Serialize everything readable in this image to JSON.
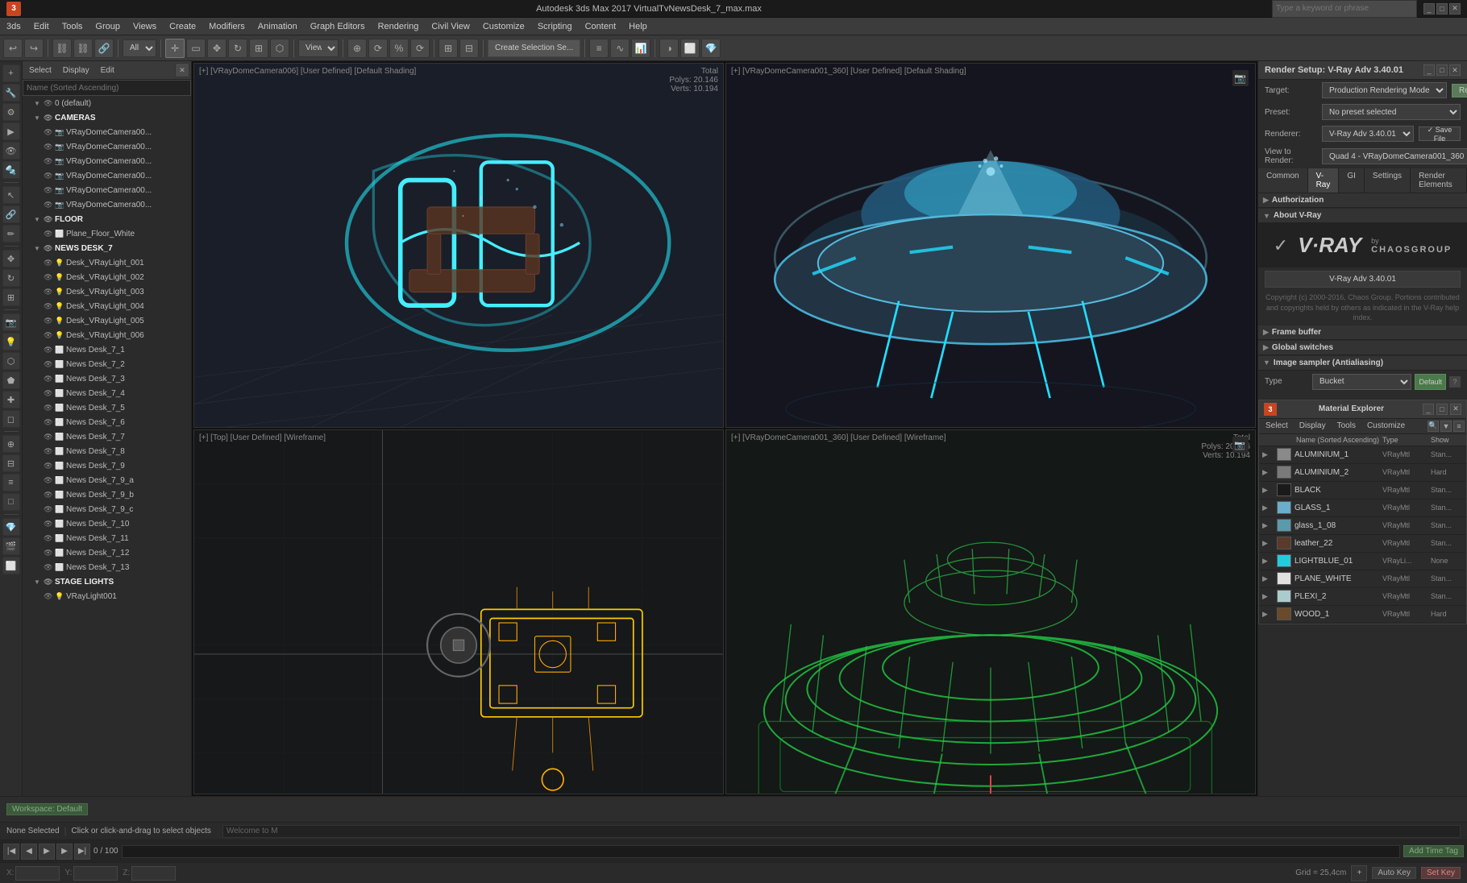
{
  "titleBar": {
    "logo": "3",
    "title": "Autodesk 3ds Max 2017  VirtualTvNewsDesk_7_max.max",
    "searchPlaceholder": "Type a keyword or phrase",
    "renderSetupTitle": "Render Setup: V-Ray Adv 3.40.01",
    "buttons": [
      "_",
      "□",
      "✕"
    ]
  },
  "menuBar": {
    "items": [
      "3",
      "Edit",
      "Tools",
      "Group",
      "Views",
      "Create",
      "Modifiers",
      "Animation",
      "Graph Editors",
      "Rendering",
      "Civil View",
      "Customize",
      "Scripting",
      "Content",
      "Help"
    ]
  },
  "toolbar": {
    "workspace": "Workspace: Default",
    "view": "View",
    "createSelection": "Create Selection Se...",
    "allLabel": "All"
  },
  "sceneTabs": {
    "select": "Select",
    "display": "Display",
    "edit": "Edit"
  },
  "sceneTree": {
    "searchPlaceholder": "Name (Sorted Ascending)",
    "items": [
      {
        "id": "default",
        "label": "0 (default)",
        "indent": 1,
        "type": "group",
        "expanded": true
      },
      {
        "id": "cameras-group",
        "label": "CAMERAS",
        "indent": 1,
        "type": "group",
        "expanded": true
      },
      {
        "id": "cam1",
        "label": "VRayDomeCamera00...",
        "indent": 2,
        "type": "camera"
      },
      {
        "id": "cam2",
        "label": "VRayDomeCamera00...",
        "indent": 2,
        "type": "camera"
      },
      {
        "id": "cam3",
        "label": "VRayDomeCamera00...",
        "indent": 2,
        "type": "camera"
      },
      {
        "id": "cam4",
        "label": "VRayDomeCamera00...",
        "indent": 2,
        "type": "camera"
      },
      {
        "id": "cam5",
        "label": "VRayDomeCamera00...",
        "indent": 2,
        "type": "camera"
      },
      {
        "id": "cam6",
        "label": "VRayDomeCamera00...",
        "indent": 2,
        "type": "camera"
      },
      {
        "id": "floor-group",
        "label": "FLOOR",
        "indent": 1,
        "type": "group",
        "expanded": true
      },
      {
        "id": "plane",
        "label": "Plane_Floor_White",
        "indent": 2,
        "type": "mesh"
      },
      {
        "id": "newsdesk-group",
        "label": "NEWS DESK_7",
        "indent": 1,
        "type": "group",
        "expanded": true
      },
      {
        "id": "desk1",
        "label": "Desk_VRayLight_001",
        "indent": 2,
        "type": "light"
      },
      {
        "id": "desk2",
        "label": "Desk_VRayLight_002",
        "indent": 2,
        "type": "light"
      },
      {
        "id": "desk3",
        "label": "Desk_VRayLight_003",
        "indent": 2,
        "type": "light"
      },
      {
        "id": "desk4",
        "label": "Desk_VRayLight_004",
        "indent": 2,
        "type": "light"
      },
      {
        "id": "desk5",
        "label": "Desk_VRayLight_005",
        "indent": 2,
        "type": "light"
      },
      {
        "id": "desk6",
        "label": "Desk_VRayLight_006",
        "indent": 2,
        "type": "light"
      },
      {
        "id": "news1",
        "label": "News Desk_7_1",
        "indent": 2,
        "type": "mesh"
      },
      {
        "id": "news2",
        "label": "News Desk_7_2",
        "indent": 2,
        "type": "mesh"
      },
      {
        "id": "news3",
        "label": "News Desk_7_3",
        "indent": 2,
        "type": "mesh"
      },
      {
        "id": "news4",
        "label": "News Desk_7_4",
        "indent": 2,
        "type": "mesh"
      },
      {
        "id": "news5",
        "label": "News Desk_7_5",
        "indent": 2,
        "type": "mesh"
      },
      {
        "id": "news6",
        "label": "News Desk_7_6",
        "indent": 2,
        "type": "mesh"
      },
      {
        "id": "news7",
        "label": "News Desk_7_7",
        "indent": 2,
        "type": "mesh"
      },
      {
        "id": "news8",
        "label": "News Desk_7_8",
        "indent": 2,
        "type": "mesh"
      },
      {
        "id": "news9",
        "label": "News Desk_7_9",
        "indent": 2,
        "type": "mesh"
      },
      {
        "id": "news9a",
        "label": "News Desk_7_9_a",
        "indent": 2,
        "type": "mesh"
      },
      {
        "id": "news9b",
        "label": "News Desk_7_9_b",
        "indent": 2,
        "type": "mesh"
      },
      {
        "id": "news9c",
        "label": "News Desk_7_9_c",
        "indent": 2,
        "type": "mesh"
      },
      {
        "id": "news10",
        "label": "News Desk_7_10",
        "indent": 2,
        "type": "mesh"
      },
      {
        "id": "news11",
        "label": "News Desk_7_11",
        "indent": 2,
        "type": "mesh"
      },
      {
        "id": "news12",
        "label": "News Desk_7_12",
        "indent": 2,
        "type": "mesh"
      },
      {
        "id": "news13",
        "label": "News Desk_7_13",
        "indent": 2,
        "type": "mesh"
      },
      {
        "id": "stage-group",
        "label": "STAGE LIGHTS",
        "indent": 1,
        "type": "group",
        "expanded": true
      },
      {
        "id": "vraylight1",
        "label": "VRayLight001",
        "indent": 2,
        "type": "light"
      }
    ]
  },
  "viewports": [
    {
      "id": "vp1",
      "label": "[+] [VRayDomeCamera006] [User Defined] [Default Shading]",
      "stats": "Total\nPolys: 20.146\nVerts: 10.194",
      "type": "shaded"
    },
    {
      "id": "vp2",
      "label": "[+] [VRayDomeCamera001_360] [User Defined] [Default Shading]",
      "stats": "",
      "type": "shaded360"
    },
    {
      "id": "vp3",
      "label": "[+] [Top] [User Defined] [Wireframe]",
      "stats": "",
      "type": "wireframe-top"
    },
    {
      "id": "vp4",
      "label": "[+] [VRayDomeCamera001_360] [User Defined] [Wireframe]",
      "stats": "Total\nPolys: 20.146\nVerts: 10.194",
      "type": "wireframe360"
    }
  ],
  "renderSetup": {
    "title": "Render Setup: V-Ray Adv 3.40.01",
    "targetLabel": "Target:",
    "targetValue": "Production Rendering Mode",
    "presetLabel": "Preset:",
    "presetValue": "No preset selected",
    "rendererLabel": "Renderer:",
    "rendererValue": "V-Ray Adv 3.40.01",
    "viewToRenderLabel": "View to\nRender:",
    "viewToRenderValue": "Quad 4 - VRayDomeCamera001_360",
    "renderButton": "Render",
    "saveFileButton": "✓ Save File",
    "tabs": [
      "Common",
      "V-Ray",
      "GI",
      "Settings",
      "Render Elements"
    ],
    "activeTab": "V-Ray",
    "sections": [
      {
        "label": "Authorization",
        "expanded": false
      },
      {
        "label": "About V-Ray",
        "expanded": true
      }
    ],
    "vrayVersion": "V-Ray Adv 3.40.01",
    "vrayCopyright": "Copyright (c) 2000-2016, Chaos Group.\nPortions contributed and copyrights held by others as indicated\nin the V-Ray help index.",
    "framebuffer": "Frame buffer",
    "globalSwitches": "Global switches",
    "imageSampler": "Image sampler (Antialiasing)",
    "typeLabel": "Type",
    "typeValue": "Bucket",
    "defaultLabel": "Default"
  },
  "materialExplorer": {
    "title": "Material Explorer",
    "toolbar": [
      "Select",
      "Display",
      "Tools",
      "Customize"
    ],
    "searchPlaceholder": "Name (Sorted Ascending)",
    "columns": [
      "Name (Sorted Ascending)",
      "Type",
      "Show"
    ],
    "materials": [
      {
        "name": "ALUMINIUM_1",
        "type": "VRayMtl",
        "show": "Stan...",
        "color": "#8a8a8a"
      },
      {
        "name": "ALUMINIUM_2",
        "type": "VRayMtl",
        "show": "Hard",
        "color": "#7a7a7a"
      },
      {
        "name": "BLACK",
        "type": "VRayMtl",
        "show": "Stan...",
        "color": "#1a1a1a"
      },
      {
        "name": "GLASS_1",
        "type": "VRayMtl",
        "show": "Stan...",
        "color": "#6aadcc"
      },
      {
        "name": "glass_1_08",
        "type": "VRayMtl",
        "show": "Stan...",
        "color": "#5a9aaa"
      },
      {
        "name": "leather_22",
        "type": "VRayMtl",
        "show": "Stan...",
        "color": "#5a3a2a"
      },
      {
        "name": "LIGHTBLUE_01",
        "type": "VRayLi...",
        "show": "None",
        "color": "#22ccdd"
      },
      {
        "name": "PLANE_WHITE",
        "type": "VRayMtl",
        "show": "Stan...",
        "color": "#e0e0e0"
      },
      {
        "name": "PLEXI_2",
        "type": "VRayMtl",
        "show": "Stan...",
        "color": "#aacccc"
      },
      {
        "name": "WOOD_1",
        "type": "VRayMtl",
        "show": "Hard",
        "color": "#6a4a2a"
      }
    ]
  },
  "bottomBar": {
    "status1": "None Selected",
    "status2": "Click or click-and-drag to select objects",
    "welcomeText": "Welcome to M",
    "workspace": "Workspace: Default"
  },
  "timeline": {
    "frame": "0 / 100",
    "timeTags": "Add Time Tag"
  },
  "coordBar": {
    "x": "",
    "y": "",
    "z": "",
    "grid": "Grid = 25,4cm",
    "autoKey": "Auto Key",
    "setKey": "Set Key"
  }
}
